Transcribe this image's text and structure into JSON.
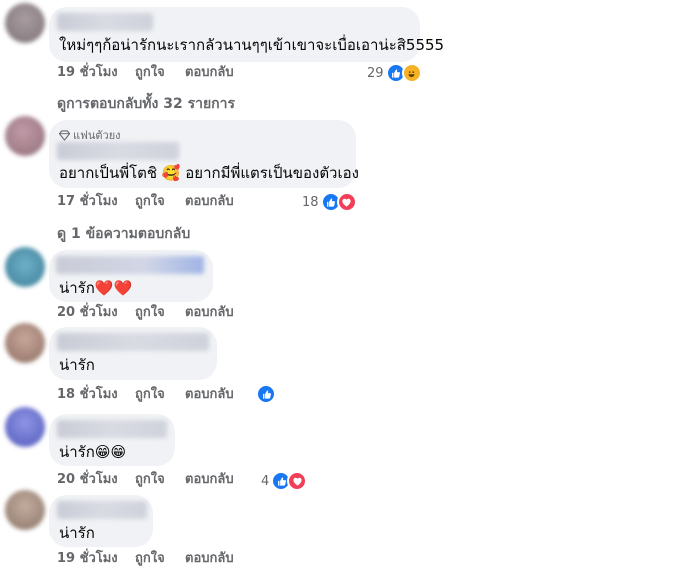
{
  "comments": [
    {
      "text": "ใหม่ๆๆก้อน่ารักนะเรากลัวนานๆๆเข้าเขาจะเบื่อเอาน่ะสิ5555",
      "time": "19 ชั่วโมง",
      "like": "ถูกใจ",
      "reply": "ตอบกลับ",
      "reaction_count": "29",
      "reactions": [
        "like-icon",
        "haha-icon"
      ]
    },
    {
      "badge": "แฟนตัวยง",
      "text": "อยากเป็นพี่โตชิ 🥰 อยากมีพี่แตรเป็นของตัวเอง",
      "time": "17 ชั่วโมง",
      "like": "ถูกใจ",
      "reply": "ตอบกลับ",
      "reaction_count": "18",
      "reactions": [
        "like-icon",
        "love-icon"
      ]
    },
    {
      "text": "น่ารัก❤️❤️",
      "time": "20 ชั่วโมง",
      "like": "ถูกใจ",
      "reply": "ตอบกลับ"
    },
    {
      "text": "น่ารัก",
      "time": "18 ชั่วโมง",
      "like": "ถูกใจ",
      "reply": "ตอบกลับ",
      "reactions": [
        "like-icon"
      ]
    },
    {
      "text": "น่ารัก😁😁",
      "time": "20 ชั่วโมง",
      "like": "ถูกใจ",
      "reply": "ตอบกลับ",
      "reaction_count": "4",
      "reactions": [
        "like-icon",
        "love-icon"
      ]
    },
    {
      "text": "น่ารัก",
      "time": "19 ชั่วโมง",
      "like": "ถูกใจ",
      "reply": "ตอบกลับ"
    }
  ],
  "view_replies": [
    "ดูการตอบกลับทั้ง 32 รายการ",
    "ดู 1 ข้อความตอบกลับ"
  ],
  "colors": {
    "bubble": "#f0f2f5",
    "meta_text": "#65676b",
    "like_blue": "#1877f2",
    "love_red": "#f33e58"
  }
}
